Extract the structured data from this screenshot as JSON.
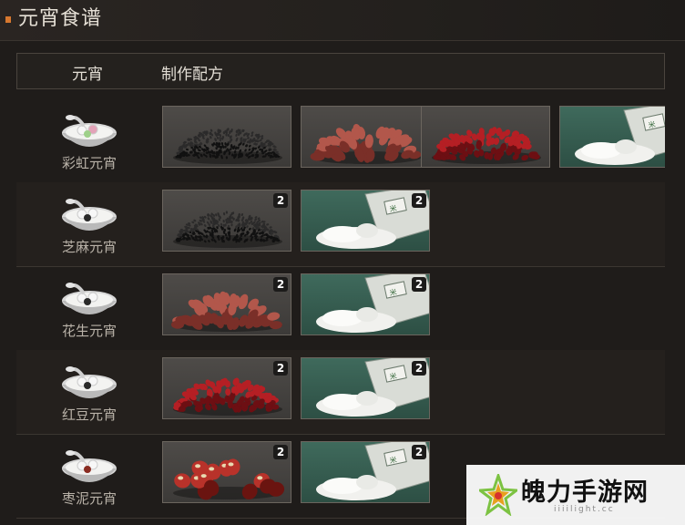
{
  "header": {
    "title": "元宵食谱"
  },
  "table": {
    "col_dish": "元宵",
    "col_recipe": "制作配方"
  },
  "rows": [
    {
      "name": "彩虹元宵",
      "ingredients": [
        {
          "item": "black-sesame",
          "count": ""
        },
        {
          "item": "peanuts",
          "count": ""
        },
        {
          "item": "red-beans",
          "count": ""
        },
        {
          "item": "glutinous-rice-flour",
          "count": ""
        }
      ]
    },
    {
      "name": "芝麻元宵",
      "ingredients": [
        {
          "item": "black-sesame",
          "count": "2"
        },
        {
          "item": "glutinous-rice-flour",
          "count": "2"
        }
      ]
    },
    {
      "name": "花生元宵",
      "ingredients": [
        {
          "item": "peanuts",
          "count": "2"
        },
        {
          "item": "glutinous-rice-flour",
          "count": "2"
        }
      ]
    },
    {
      "name": "红豆元宵",
      "ingredients": [
        {
          "item": "red-beans",
          "count": "2"
        },
        {
          "item": "glutinous-rice-flour",
          "count": "2"
        }
      ]
    },
    {
      "name": "枣泥元宵",
      "ingredients": [
        {
          "item": "red-dates",
          "count": "2"
        },
        {
          "item": "glutinous-rice-flour",
          "count": "2"
        }
      ]
    }
  ],
  "watermark": {
    "text": "魄力手游网",
    "site": "iiiilight.cc"
  },
  "colors": {
    "accent_marker": "#d7782f",
    "slot_grey": "#4e4b48",
    "slot_green": "#3f6a5c"
  }
}
